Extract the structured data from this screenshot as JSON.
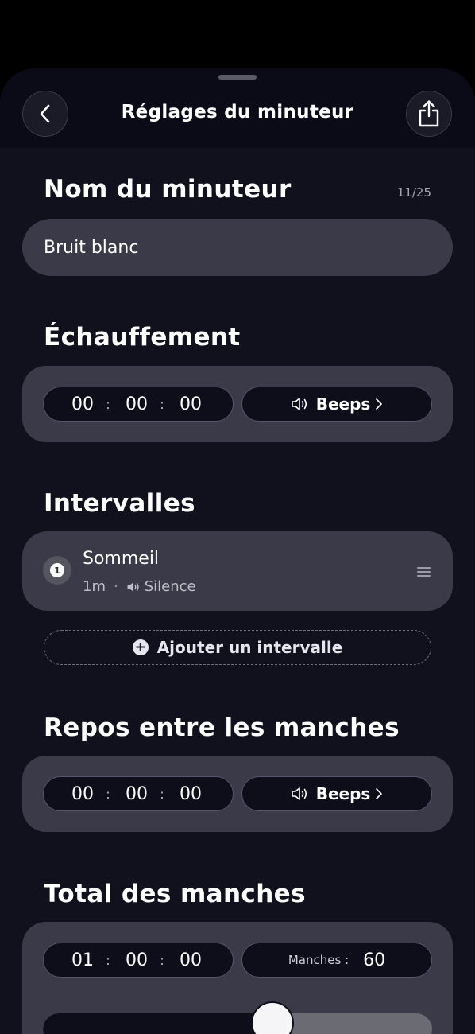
{
  "header": {
    "title": "Réglages du minuteur",
    "back_icon": "chevron-left-icon",
    "share_icon": "share-icon"
  },
  "timer_name": {
    "label": "Nom du minuteur",
    "counter": "11/25",
    "value": "Bruit blanc"
  },
  "warmup": {
    "label": "Échauffement",
    "hours": "00",
    "minutes": "00",
    "seconds": "00",
    "separator": ":",
    "sound_label": "Beeps"
  },
  "intervals": {
    "label": "Intervalles",
    "items": [
      {
        "index": "1",
        "name": "Sommeil",
        "duration": "1m",
        "dot": "·",
        "sound": "Silence"
      }
    ],
    "add_label": "Ajouter un intervalle"
  },
  "rest": {
    "label": "Repos entre les manches",
    "hours": "00",
    "minutes": "00",
    "seconds": "00",
    "separator": ":",
    "sound_label": "Beeps"
  },
  "total": {
    "label": "Total des manches",
    "hours": "01",
    "minutes": "00",
    "seconds": "00",
    "separator": ":",
    "rounds_label": "Manches :",
    "rounds_value": "60",
    "slider_fraction": 0.59
  },
  "colors": {
    "background": "#11111e",
    "card": "#3a3a48",
    "pill": "#0e0e1a",
    "text": "#ffffff"
  }
}
